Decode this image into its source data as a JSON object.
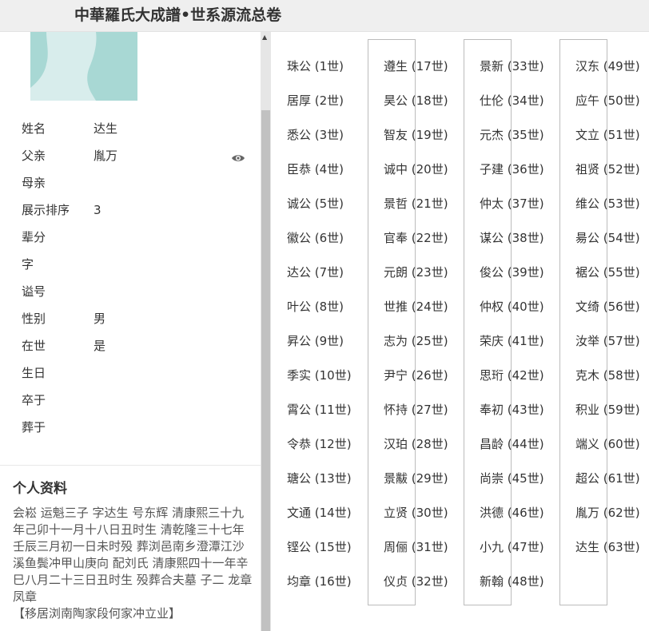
{
  "header": {
    "title": "中華羅氏大成譜•世系源流总卷"
  },
  "person": {
    "fields": [
      {
        "label": "姓名",
        "value": "达生"
      },
      {
        "label": "父亲",
        "value": "胤万",
        "has_eye": true
      },
      {
        "label": "母亲",
        "value": ""
      },
      {
        "label": "展示排序",
        "value": "3"
      },
      {
        "label": "辈分",
        "value": ""
      },
      {
        "label": "字",
        "value": ""
      },
      {
        "label": "谥号",
        "value": ""
      },
      {
        "label": "性别",
        "value": "男"
      },
      {
        "label": "在世",
        "value": "是"
      },
      {
        "label": "生日",
        "value": ""
      },
      {
        "label": "卒于",
        "value": ""
      },
      {
        "label": "葬于",
        "value": ""
      }
    ],
    "icons": {
      "father_view": "eye-icon",
      "scroll_up": "scroll-up-arrow-icon"
    }
  },
  "bio": {
    "title": "个人资料",
    "text": "会崧 运魁三子 字达生 号东辉 清康熙三十九年己卯十一月十八日丑时生 清乾隆三十七年壬辰三月初一日未时殁 葬浏邑南乡澄潭江沙溪鱼鬓冲甲山庚向 配刘氏 清康熙四十一年辛巳八月二十三日丑时生 殁葬合夫墓 子二 龙章 凤章",
    "note": "【移居浏南陶家段何家冲立业】"
  },
  "generations": [
    [
      "珠公 (1世)",
      "居厚 (2世)",
      "悉公 (3世)",
      "臣恭 (4世)",
      "诚公 (5世)",
      "徽公 (6世)",
      "达公 (7世)",
      "叶公 (8世)",
      "昇公 (9世)",
      "季实 (10世)",
      "霄公 (11世)",
      "令恭 (12世)",
      "瑭公 (13世)",
      "文通 (14世)",
      "铿公 (15世)",
      "均章 (16世)"
    ],
    [
      "遵生 (17世)",
      "昊公 (18世)",
      "智友 (19世)",
      "诚中 (20世)",
      "景哲 (21世)",
      "官奉 (22世)",
      "元朗 (23世)",
      "世推 (24世)",
      "志为 (25世)",
      "尹宁 (26世)",
      "怀持 (27世)",
      "汉珀 (28世)",
      "景黻 (29世)",
      "立贤 (30世)",
      "周俪 (31世)",
      "仪贞 (32世)"
    ],
    [
      "景新 (33世)",
      "仕伦 (34世)",
      "元杰 (35世)",
      "子建 (36世)",
      "仲太 (37世)",
      "谋公 (38世)",
      "俊公 (39世)",
      "仲权 (40世)",
      "荣庆 (41世)",
      "思珩 (42世)",
      "奉初 (43世)",
      "昌龄 (44世)",
      "尚崇 (45世)",
      "洪德 (46世)",
      "小九 (47世)",
      "新翰 (48世)"
    ],
    [
      "汉东 (49世)",
      "应午 (50世)",
      "文立 (51世)",
      "祖贤 (52世)",
      "维公 (53世)",
      "昜公 (54世)",
      "裾公 (55世)",
      "文绮 (56世)",
      "汝举 (57世)",
      "克木 (58世)",
      "积业 (59世)",
      "端义 (60世)",
      "超公 (61世)",
      "胤万 (62世)",
      "达生 (63世)"
    ]
  ]
}
